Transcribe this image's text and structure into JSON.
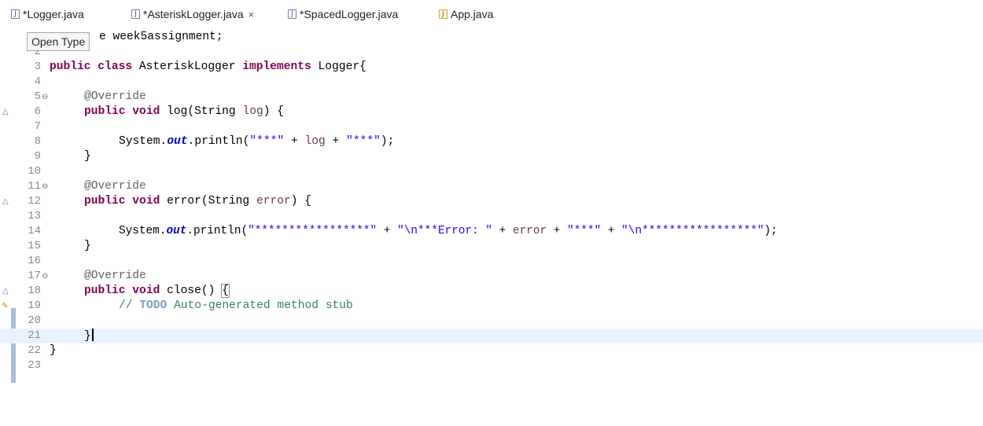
{
  "tabs": [
    {
      "label": "*Logger.java",
      "icon": "java-file-icon"
    },
    {
      "label": "*AsteriskLogger.java",
      "icon": "java-file-icon",
      "close": "×"
    },
    {
      "label": "*SpacedLogger.java",
      "icon": "java-file-icon"
    },
    {
      "label": "App.java",
      "icon": "java-app-file-icon"
    }
  ],
  "tooltip": "Open Type",
  "line_numbers": [
    "2",
    "3",
    "4",
    "5",
    "6",
    "7",
    "8",
    "9",
    "10",
    "11",
    "12",
    "13",
    "14",
    "15",
    "16",
    "17",
    "18",
    "19",
    "20",
    "21",
    "22",
    "23"
  ],
  "code": {
    "l1_tail": "e week5assignment;",
    "l3a": "public class",
    "l3b": " AsteriskLogger ",
    "l3c": "implements",
    "l3d": " Logger{",
    "override": "@Override",
    "l6a": "public void",
    "l6b": " log(String ",
    "l6c": "log",
    "l6d": ") {",
    "sys": "System.",
    "out": "out",
    "l8a": ".println(",
    "l8b": "\"***\"",
    "l8c": " + ",
    "l8d": "log",
    "l8e": " + ",
    "l8f": "\"***\"",
    "l8g": ");",
    "brace": "}",
    "l12a": "public void",
    "l12b": " error(String ",
    "l12c": "error",
    "l12d": ") {",
    "l14a": ".println(",
    "l14b": "\"*****************\"",
    "l14c": " + ",
    "l14d": "\"\\n***Error: \"",
    "l14e": " + ",
    "l14f": "error",
    "l14g": " + ",
    "l14h": "\"***\"",
    "l14i": " + ",
    "l14j": "\"\\n*****************\"",
    "l14k": ");",
    "l18a": "public void",
    "l18b": " close() ",
    "l18c": "{",
    "l19a": "// ",
    "l19b": "TODO",
    "l19c": " Auto-generated method stub"
  },
  "colors": {
    "keyword": "#7f0055",
    "string": "#2a00ff",
    "comment": "#3f7f5f",
    "current_line": "#e8f2fe"
  }
}
